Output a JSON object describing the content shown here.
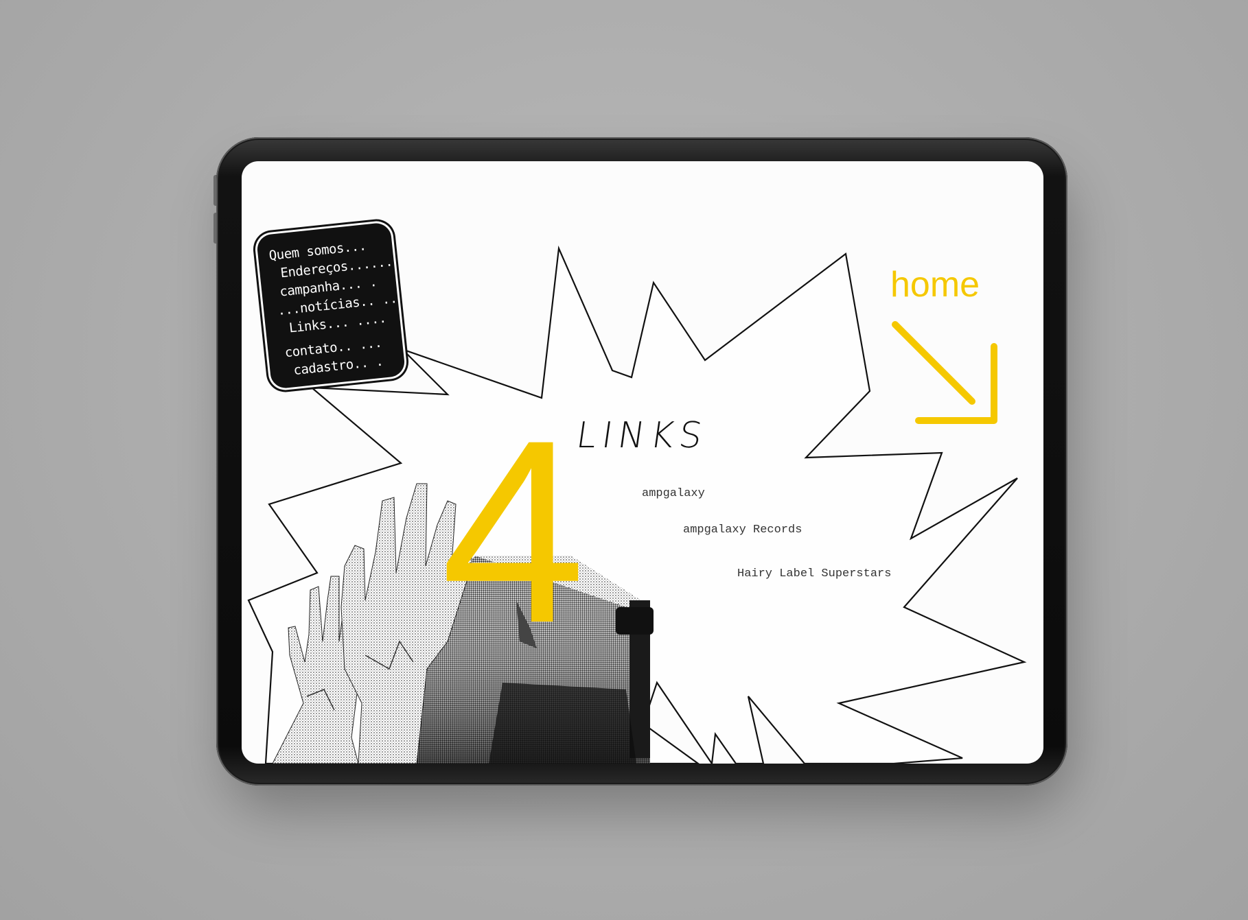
{
  "page": {
    "background_color": "#b3b3b3",
    "accent_color": "#f5c800"
  },
  "menu": {
    "items": [
      {
        "label": "Quem somos..."
      },
      {
        "label": "Endereços......"
      },
      {
        "label": "campanha... ."
      },
      {
        "label": "...notícias.. .."
      },
      {
        "label": "Links... ...."
      },
      {
        "label": "contato.. ..."
      },
      {
        "label": "cadastro.. ."
      }
    ]
  },
  "home": {
    "label": "home",
    "icon": "arrow-down-right-icon"
  },
  "section": {
    "number": "4",
    "title": "LINKS"
  },
  "links": [
    {
      "label": "ampgalaxy"
    },
    {
      "label": "ampgalaxy Records"
    },
    {
      "label": "Hairy Label Superstars"
    }
  ]
}
